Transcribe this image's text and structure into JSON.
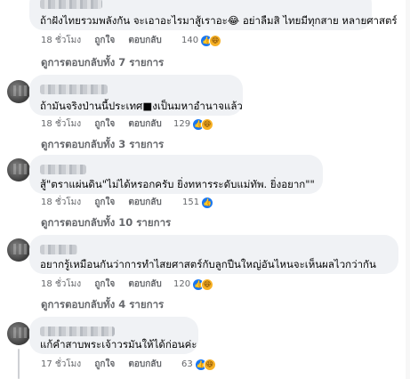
{
  "colors": {
    "bubble": "#f0f2f5",
    "meta": "#65676b",
    "like": "#1877f2",
    "haha": "#f7b125"
  },
  "comments": [
    {
      "text": "ถ้าฝังไทยรวมพลังกัน จะเอาอะไรมาสู้เราอะ😂 อย่าลืมสิ ไทยมีทุกสาย หลายศาสตร์",
      "time": "18 ชั่วโมง",
      "like": "ถูกใจ",
      "reply": "ตอบกลับ",
      "reactions": "140",
      "icons": [
        "like-icon",
        "haha-icon"
      ],
      "replies": "ดูการตอบกลับทั้ง 7 รายการ"
    },
    {
      "text": "ถ้ามันจริงป่านนี้ประเทศ■งเป็นมหาอำนาจแล้ว",
      "time": "18 ชั่วโมง",
      "like": "ถูกใจ",
      "reply": "ตอบกลับ",
      "reactions": "129",
      "icons": [
        "like-icon",
        "haha-icon"
      ],
      "replies": "ดูการตอบกลับทั้ง 3 รายการ"
    },
    {
      "text": "สู้\"ตราแผ่นดิน\"ไม่ได้หรอกครับ ยิ่งทหารระดับแม่ทัพ. ยิ่งอยาก\"\"",
      "time": "18 ชั่วโมง",
      "like": "ถูกใจ",
      "reply": "ตอบกลับ",
      "reactions": "151",
      "icons": [
        "like-icon"
      ],
      "replies": "ดูการตอบกลับทั้ง 10 รายการ"
    },
    {
      "text": "อยากรู้เหมือนกันว่าการทำไสยศาสตร์กับลูกปืนใหญ่อันไหนจะเห็นผลไวกว่ากัน",
      "time": "18 ชั่วโมง",
      "like": "ถูกใจ",
      "reply": "ตอบกลับ",
      "reactions": "120",
      "icons": [
        "like-icon",
        "haha-icon"
      ],
      "replies": "ดูการตอบกลับทั้ง 4 รายการ"
    },
    {
      "text": "แก้คำสาบพระเจ้าวรมันให้ได้ก่อนค่ะ",
      "time": "17 ชั่วโมง",
      "like": "ถูกใจ",
      "reply": "ตอบกลับ",
      "reactions": "63",
      "icons": [
        "like-icon",
        "haha-icon"
      ],
      "replies": ""
    }
  ]
}
